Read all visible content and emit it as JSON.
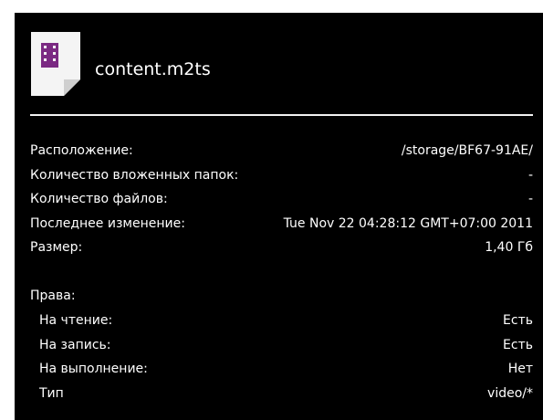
{
  "file": {
    "name": "content.m2ts",
    "icon": "video-file-icon",
    "icon_accent": "#7b2a83"
  },
  "details": [
    {
      "label": "Расположение:",
      "value": "/storage/BF67-91AE/"
    },
    {
      "label": "Количество вложенных папок:",
      "value": "-"
    },
    {
      "label": "Количество файлов:",
      "value": "-"
    },
    {
      "label": "Последнее изменение:",
      "value": "Tue Nov 22 04:28:12 GMT+07:00 2011"
    },
    {
      "label": "Размер:",
      "value": "1,40 Гб"
    }
  ],
  "permissions": {
    "heading": "Права:",
    "items": [
      {
        "label": "На чтение:",
        "value": "Есть"
      },
      {
        "label": "На запись:",
        "value": "Есть"
      },
      {
        "label": "На выполнение:",
        "value": "Нет"
      },
      {
        "label": "Тип",
        "value": "video/*"
      }
    ]
  }
}
